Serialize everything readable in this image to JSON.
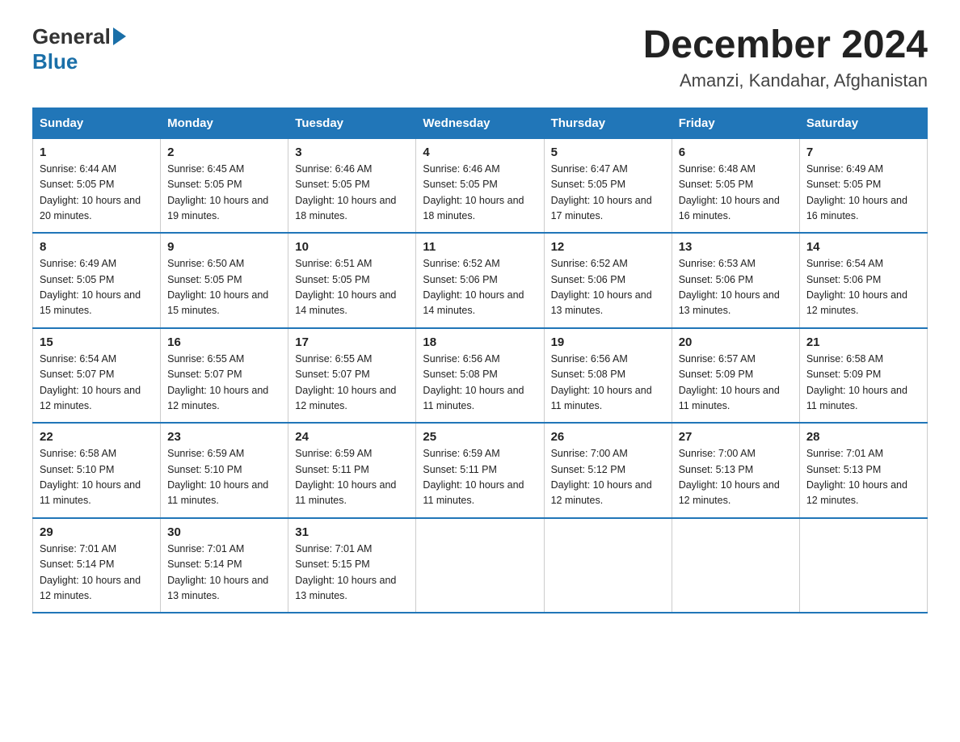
{
  "logo": {
    "general": "General",
    "blue": "Blue"
  },
  "title": "December 2024",
  "location": "Amanzi, Kandahar, Afghanistan",
  "days_of_week": [
    "Sunday",
    "Monday",
    "Tuesday",
    "Wednesday",
    "Thursday",
    "Friday",
    "Saturday"
  ],
  "weeks": [
    [
      {
        "day": "1",
        "sunrise": "6:44 AM",
        "sunset": "5:05 PM",
        "daylight": "10 hours and 20 minutes."
      },
      {
        "day": "2",
        "sunrise": "6:45 AM",
        "sunset": "5:05 PM",
        "daylight": "10 hours and 19 minutes."
      },
      {
        "day": "3",
        "sunrise": "6:46 AM",
        "sunset": "5:05 PM",
        "daylight": "10 hours and 18 minutes."
      },
      {
        "day": "4",
        "sunrise": "6:46 AM",
        "sunset": "5:05 PM",
        "daylight": "10 hours and 18 minutes."
      },
      {
        "day": "5",
        "sunrise": "6:47 AM",
        "sunset": "5:05 PM",
        "daylight": "10 hours and 17 minutes."
      },
      {
        "day": "6",
        "sunrise": "6:48 AM",
        "sunset": "5:05 PM",
        "daylight": "10 hours and 16 minutes."
      },
      {
        "day": "7",
        "sunrise": "6:49 AM",
        "sunset": "5:05 PM",
        "daylight": "10 hours and 16 minutes."
      }
    ],
    [
      {
        "day": "8",
        "sunrise": "6:49 AM",
        "sunset": "5:05 PM",
        "daylight": "10 hours and 15 minutes."
      },
      {
        "day": "9",
        "sunrise": "6:50 AM",
        "sunset": "5:05 PM",
        "daylight": "10 hours and 15 minutes."
      },
      {
        "day": "10",
        "sunrise": "6:51 AM",
        "sunset": "5:05 PM",
        "daylight": "10 hours and 14 minutes."
      },
      {
        "day": "11",
        "sunrise": "6:52 AM",
        "sunset": "5:06 PM",
        "daylight": "10 hours and 14 minutes."
      },
      {
        "day": "12",
        "sunrise": "6:52 AM",
        "sunset": "5:06 PM",
        "daylight": "10 hours and 13 minutes."
      },
      {
        "day": "13",
        "sunrise": "6:53 AM",
        "sunset": "5:06 PM",
        "daylight": "10 hours and 13 minutes."
      },
      {
        "day": "14",
        "sunrise": "6:54 AM",
        "sunset": "5:06 PM",
        "daylight": "10 hours and 12 minutes."
      }
    ],
    [
      {
        "day": "15",
        "sunrise": "6:54 AM",
        "sunset": "5:07 PM",
        "daylight": "10 hours and 12 minutes."
      },
      {
        "day": "16",
        "sunrise": "6:55 AM",
        "sunset": "5:07 PM",
        "daylight": "10 hours and 12 minutes."
      },
      {
        "day": "17",
        "sunrise": "6:55 AM",
        "sunset": "5:07 PM",
        "daylight": "10 hours and 12 minutes."
      },
      {
        "day": "18",
        "sunrise": "6:56 AM",
        "sunset": "5:08 PM",
        "daylight": "10 hours and 11 minutes."
      },
      {
        "day": "19",
        "sunrise": "6:56 AM",
        "sunset": "5:08 PM",
        "daylight": "10 hours and 11 minutes."
      },
      {
        "day": "20",
        "sunrise": "6:57 AM",
        "sunset": "5:09 PM",
        "daylight": "10 hours and 11 minutes."
      },
      {
        "day": "21",
        "sunrise": "6:58 AM",
        "sunset": "5:09 PM",
        "daylight": "10 hours and 11 minutes."
      }
    ],
    [
      {
        "day": "22",
        "sunrise": "6:58 AM",
        "sunset": "5:10 PM",
        "daylight": "10 hours and 11 minutes."
      },
      {
        "day": "23",
        "sunrise": "6:59 AM",
        "sunset": "5:10 PM",
        "daylight": "10 hours and 11 minutes."
      },
      {
        "day": "24",
        "sunrise": "6:59 AM",
        "sunset": "5:11 PM",
        "daylight": "10 hours and 11 minutes."
      },
      {
        "day": "25",
        "sunrise": "6:59 AM",
        "sunset": "5:11 PM",
        "daylight": "10 hours and 11 minutes."
      },
      {
        "day": "26",
        "sunrise": "7:00 AM",
        "sunset": "5:12 PM",
        "daylight": "10 hours and 12 minutes."
      },
      {
        "day": "27",
        "sunrise": "7:00 AM",
        "sunset": "5:13 PM",
        "daylight": "10 hours and 12 minutes."
      },
      {
        "day": "28",
        "sunrise": "7:01 AM",
        "sunset": "5:13 PM",
        "daylight": "10 hours and 12 minutes."
      }
    ],
    [
      {
        "day": "29",
        "sunrise": "7:01 AM",
        "sunset": "5:14 PM",
        "daylight": "10 hours and 12 minutes."
      },
      {
        "day": "30",
        "sunrise": "7:01 AM",
        "sunset": "5:14 PM",
        "daylight": "10 hours and 13 minutes."
      },
      {
        "day": "31",
        "sunrise": "7:01 AM",
        "sunset": "5:15 PM",
        "daylight": "10 hours and 13 minutes."
      },
      null,
      null,
      null,
      null
    ]
  ]
}
